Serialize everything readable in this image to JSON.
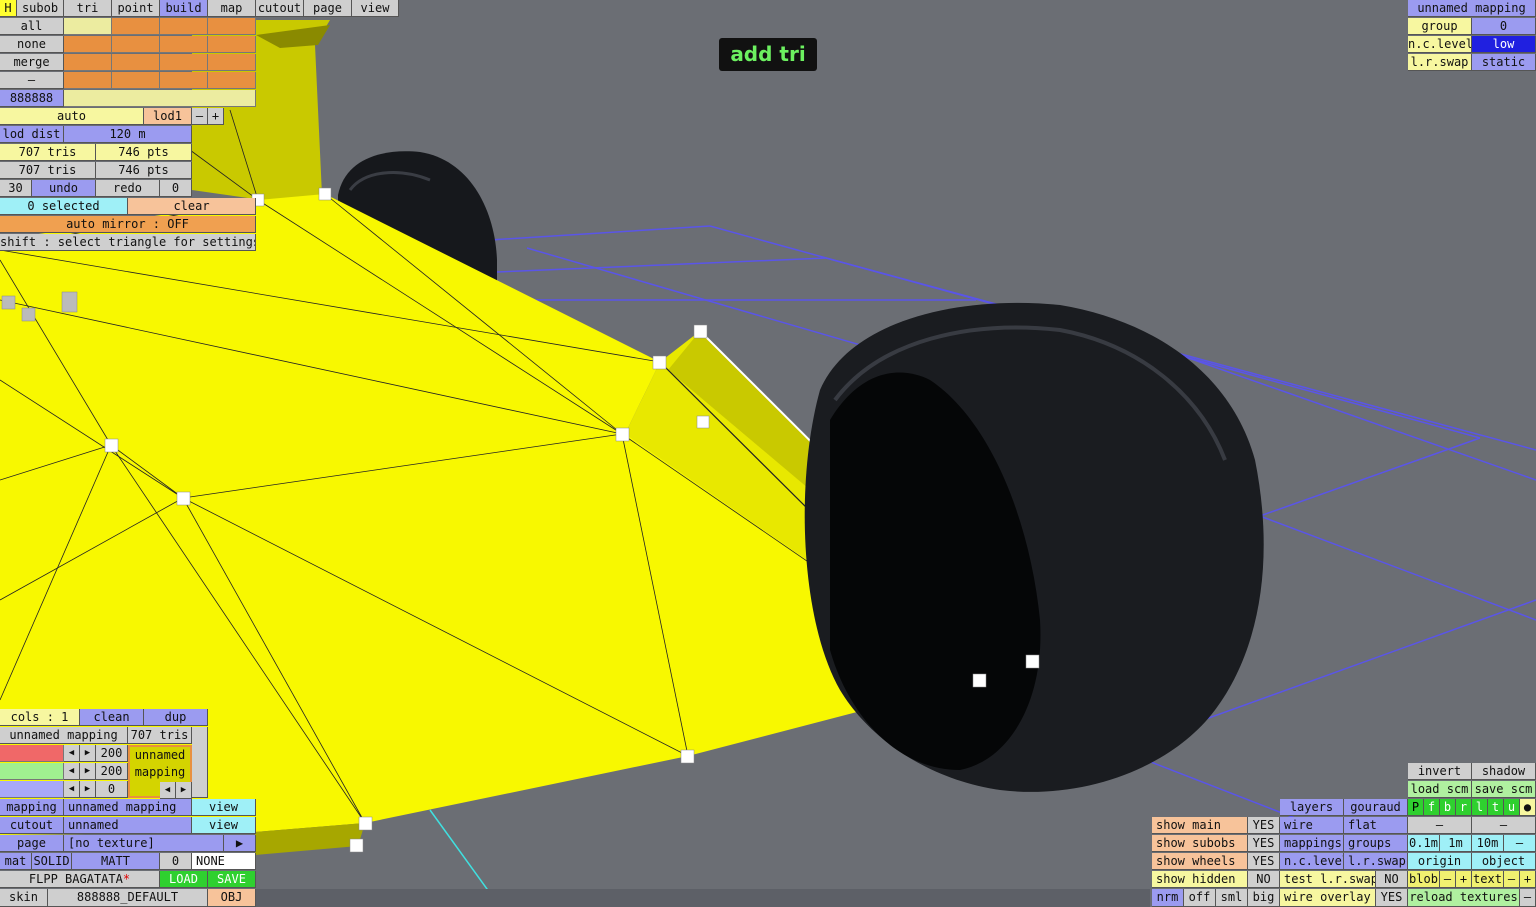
{
  "overlay": {
    "mode_label": "add tri"
  },
  "top_menu": {
    "h": "H",
    "tabs": [
      "subob",
      "tri",
      "point",
      "build",
      "map",
      "cutout",
      "page",
      "view"
    ]
  },
  "sel_panel": {
    "all": "all",
    "none": "none",
    "merge": "merge",
    "dash": "–",
    "color_code": "888888",
    "auto": "auto",
    "lod": "lod1",
    "minus": "–",
    "plus": "+",
    "lod_dist_label": "lod dist",
    "lod_dist_value": "120 m",
    "tris1": "707 tris",
    "pts1": "746 pts",
    "tris2": "707 tris",
    "pts2": "746 pts",
    "undo_count": "30",
    "undo": "undo",
    "redo": "redo",
    "redo_count": "0",
    "selected": "0 selected",
    "clear": "clear",
    "auto_mirror": "auto mirror : OFF",
    "hint": "shift : select triangle for settings"
  },
  "mapping_panel": {
    "title": "unnamed mapping",
    "group_label": "group",
    "group_value": "0",
    "nc_level_label": "n.c.level",
    "nc_level_value": "low",
    "lr_swap_label": "l.r.swap",
    "lr_swap_value": "static"
  },
  "bottom_left": {
    "cols": "cols : 1",
    "clean": "clean",
    "dup": "dup",
    "mapping_name": "unnamed mapping",
    "tris": "707 tris",
    "v1": "200",
    "v2": "200",
    "v3": "0",
    "preview_line1": "unnamed",
    "preview_line2": "mapping",
    "mapping_label": "mapping",
    "mapping_value": "unnamed mapping",
    "view": "view",
    "cutout_label": "cutout",
    "cutout_value": "unnamed",
    "view2": "view",
    "page_label": "page",
    "page_value": "[no texture]",
    "page_arrow": "▶",
    "mat": "mat",
    "solid": "SOLID",
    "matt": "MATT",
    "mat_num": "0",
    "mat_none": "NONE",
    "car_name": "FLPP BAGATATA",
    "asterisk": "*",
    "load": "LOAD",
    "save": "SAVE",
    "skin_label": "skin",
    "skin_value": "888888_DEFAULT",
    "obj": "OBJ"
  },
  "bottom_right": {
    "invert": "invert",
    "shadow": "shadow",
    "load_scm": "load scm",
    "save_scm": "save scm",
    "layers": "layers",
    "gouraud": "gouraud",
    "flags": [
      "P",
      "f",
      "b",
      "r",
      "l",
      "t",
      "u",
      "●"
    ],
    "show_main": "show main",
    "show_main_v": "YES",
    "wire": "wire",
    "flat": "flat",
    "dash1": "–",
    "dash2": "–",
    "show_subobs": "show subobs",
    "show_subobs_v": "YES",
    "mappings": "mappings",
    "groups": "groups",
    "step1": "0.1m",
    "step2": "1m",
    "step3": "10m",
    "step_minus": "–",
    "show_wheels": "show wheels",
    "show_wheels_v": "YES",
    "nc_level": "n.c.level",
    "lr_swap": "l.r.swap",
    "origin": "origin",
    "object": "object",
    "show_hidden": "show hidden",
    "show_hidden_v": "NO",
    "test_lr_swap": "test l.r.swap",
    "test_lr_swap_v": "NO",
    "blob": "blob",
    "blob_minus": "–",
    "blob_plus": "+",
    "text": "text",
    "text_minus": "–",
    "text_plus": "+",
    "nrm": "nrm",
    "off": "off",
    "sml": "sml",
    "big": "big",
    "wire_overlay": "wire overlay",
    "wire_overlay_v": "YES",
    "reload_textures": "reload textures",
    "reload_minus": "–"
  },
  "colors": {
    "background": "#6b6e74",
    "body_yellow": "#f8f800",
    "accent_blue": "#9b9bf0",
    "accent_orange": "#f0a050"
  }
}
